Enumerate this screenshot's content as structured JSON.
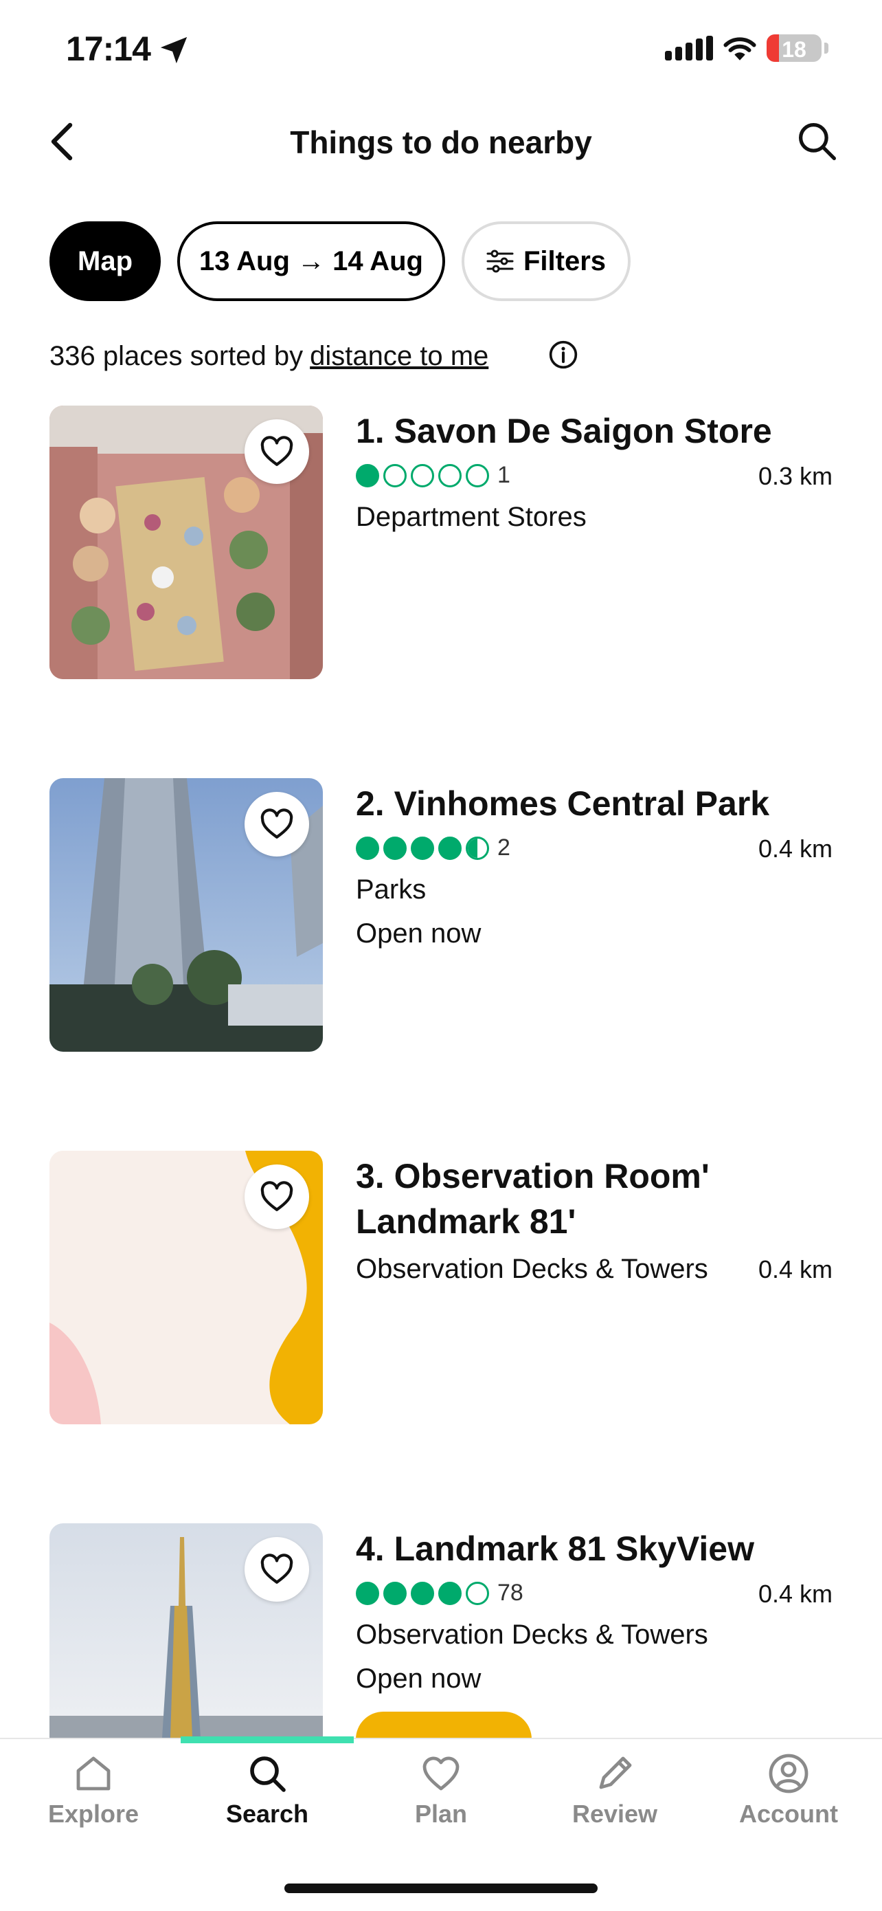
{
  "status_bar": {
    "time": "17:14",
    "battery": "18"
  },
  "header": {
    "title": "Things to do nearby"
  },
  "chips": {
    "map": "Map",
    "dates": "13 Aug → 14 Aug",
    "filters": "Filters"
  },
  "summary": {
    "prefix": "336 places sorted by",
    "link": "distance to me"
  },
  "listings": [
    {
      "title": "1. Savon De Saigon Store",
      "rating": 1,
      "reviews": "1",
      "distance": "0.3 km",
      "category": "Department Stores",
      "status": ""
    },
    {
      "title": "2. Vinhomes Central Park",
      "rating": 4.5,
      "reviews": "2",
      "distance": "0.4 km",
      "category": "Parks",
      "status": "Open now"
    },
    {
      "title_line1": "3. Observation Room'",
      "title_line2": "Landmark 81'",
      "distance": "0.4 km",
      "category": "Observation Decks & Towers"
    },
    {
      "title": "4. Landmark 81 SkyView",
      "rating": 4,
      "reviews": "78",
      "distance": "0.4 km",
      "category": "Observation Decks & Towers",
      "status": "Open now"
    }
  ],
  "bottom_nav": [
    {
      "label": "Explore",
      "icon": "home-icon"
    },
    {
      "label": "Search",
      "icon": "search-icon",
      "active": true
    },
    {
      "label": "Plan",
      "icon": "heart-icon"
    },
    {
      "label": "Review",
      "icon": "pencil-icon"
    },
    {
      "label": "Account",
      "icon": "user-circle-icon"
    }
  ],
  "colors": {
    "rating_green": "#00aa6c",
    "accent_yellow": "#f2b203",
    "nav_indicator": "#3fe0b0"
  }
}
